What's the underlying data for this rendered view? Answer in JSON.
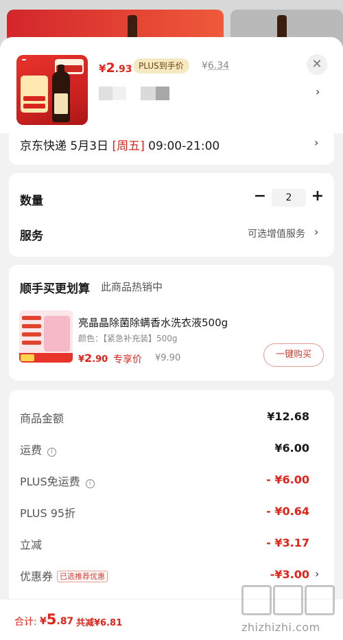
{
  "product": {
    "price_symbol": "¥",
    "price_int": "2",
    "price_dec": ".93",
    "plus_tag": "PLUS到手价",
    "orig_symbol": "¥",
    "orig_price": "6.34"
  },
  "delivery": {
    "prefix": "京东快递 5月3日 ",
    "weekday": "[周五]",
    "time": " 09:00-21:00"
  },
  "quantity": {
    "label": "数量",
    "minus": "−",
    "value": "2",
    "plus": "+"
  },
  "service": {
    "label": "服务",
    "option": "可选增值服务"
  },
  "recommend": {
    "title": "顺手买更划算",
    "subtitle": "此商品热销中",
    "item_name": "亮晶晶除菌除螨香水洗衣液500g",
    "item_variant": "颜色：【紧急补充装】500g",
    "price_symbol": "¥",
    "price_int": "2",
    "price_dec": ".90",
    "price_label": "专享价",
    "orig_price": "¥9.90",
    "buy_button": "一键购买"
  },
  "summary": {
    "rows": [
      {
        "label": "商品金额",
        "value": "¥12.68"
      },
      {
        "label": "运费",
        "value": "¥6.00"
      },
      {
        "label": "PLUS免运费",
        "value": "- ¥6.00"
      },
      {
        "label": "PLUS 95折",
        "value": "- ¥0.64"
      },
      {
        "label": "立减",
        "value": "- ¥3.17"
      },
      {
        "label": "优惠券",
        "value": "-¥3.00",
        "tag": "已选推荐优惠"
      }
    ]
  },
  "footer": {
    "total_label": "合计:",
    "total_symbol": "¥",
    "total_int": "5",
    "total_dec": ".87",
    "total_save": "共减¥6.81"
  },
  "watermark": {
    "text": "zhizhizhi.com"
  },
  "icons": {
    "close": "close-icon",
    "chevron": "chevron-right-icon",
    "info": "info-icon"
  },
  "colors": {
    "accent_red": "#e2231a",
    "plus_gold_bg": "#f6e8c0"
  }
}
